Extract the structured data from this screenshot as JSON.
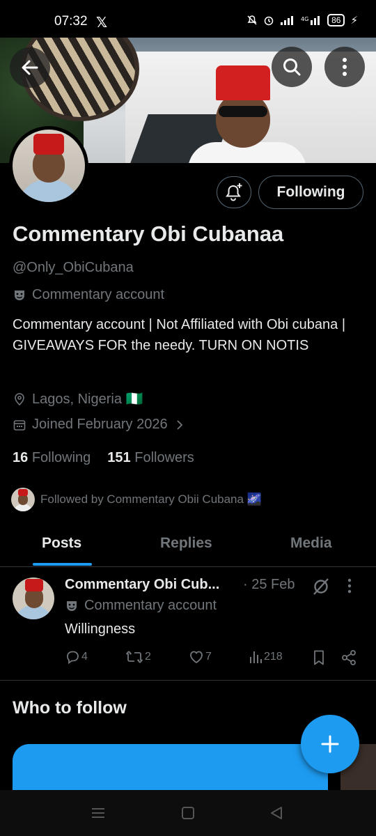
{
  "status_bar": {
    "time": "07:32",
    "app_icon": "x-logo",
    "battery": "86",
    "icons": [
      "mute-icon",
      "alarm-icon",
      "signal-icon",
      "4g-icon",
      "battery-icon"
    ]
  },
  "header": {
    "back_icon": "arrow-left-icon",
    "search_icon": "search-icon",
    "more_icon": "more-vertical-icon"
  },
  "profile": {
    "notify_icon": "bell-plus-icon",
    "follow_button_label": "Following",
    "display_name": "Commentary Obi Cubanaa",
    "handle": "@Only_ObiCubana",
    "account_label": "Commentary account",
    "bio": "Commentary account | Not Affiliated with Obi cubana | GIVEAWAYS FOR the needy. TURN ON NOTIS",
    "location": "Lagos, Nigeria 🇳🇬",
    "joined": "Joined February 2026",
    "following_count": "16",
    "following_label": "Following",
    "followers_count": "151",
    "followers_label": "Followers",
    "followed_by": "Followed by Commentary Obii Cubana 🌌"
  },
  "tabs": [
    {
      "label": "Posts",
      "active": true
    },
    {
      "label": "Replies",
      "active": false
    },
    {
      "label": "Media",
      "active": false
    }
  ],
  "tweet": {
    "author": "Commentary Obi Cub...",
    "date": "· 25 Feb",
    "label": "Commentary account",
    "text": "Willingness",
    "replies": "4",
    "reposts": "2",
    "likes": "7",
    "views": "218"
  },
  "who_to_follow": {
    "title": "Who to follow"
  },
  "fab_icon": "plus-icon",
  "colors": {
    "accent": "#1d9bf0",
    "background": "#000000",
    "text_primary": "#e7e9ea",
    "text_secondary": "#71767b",
    "border": "#2f3336"
  }
}
